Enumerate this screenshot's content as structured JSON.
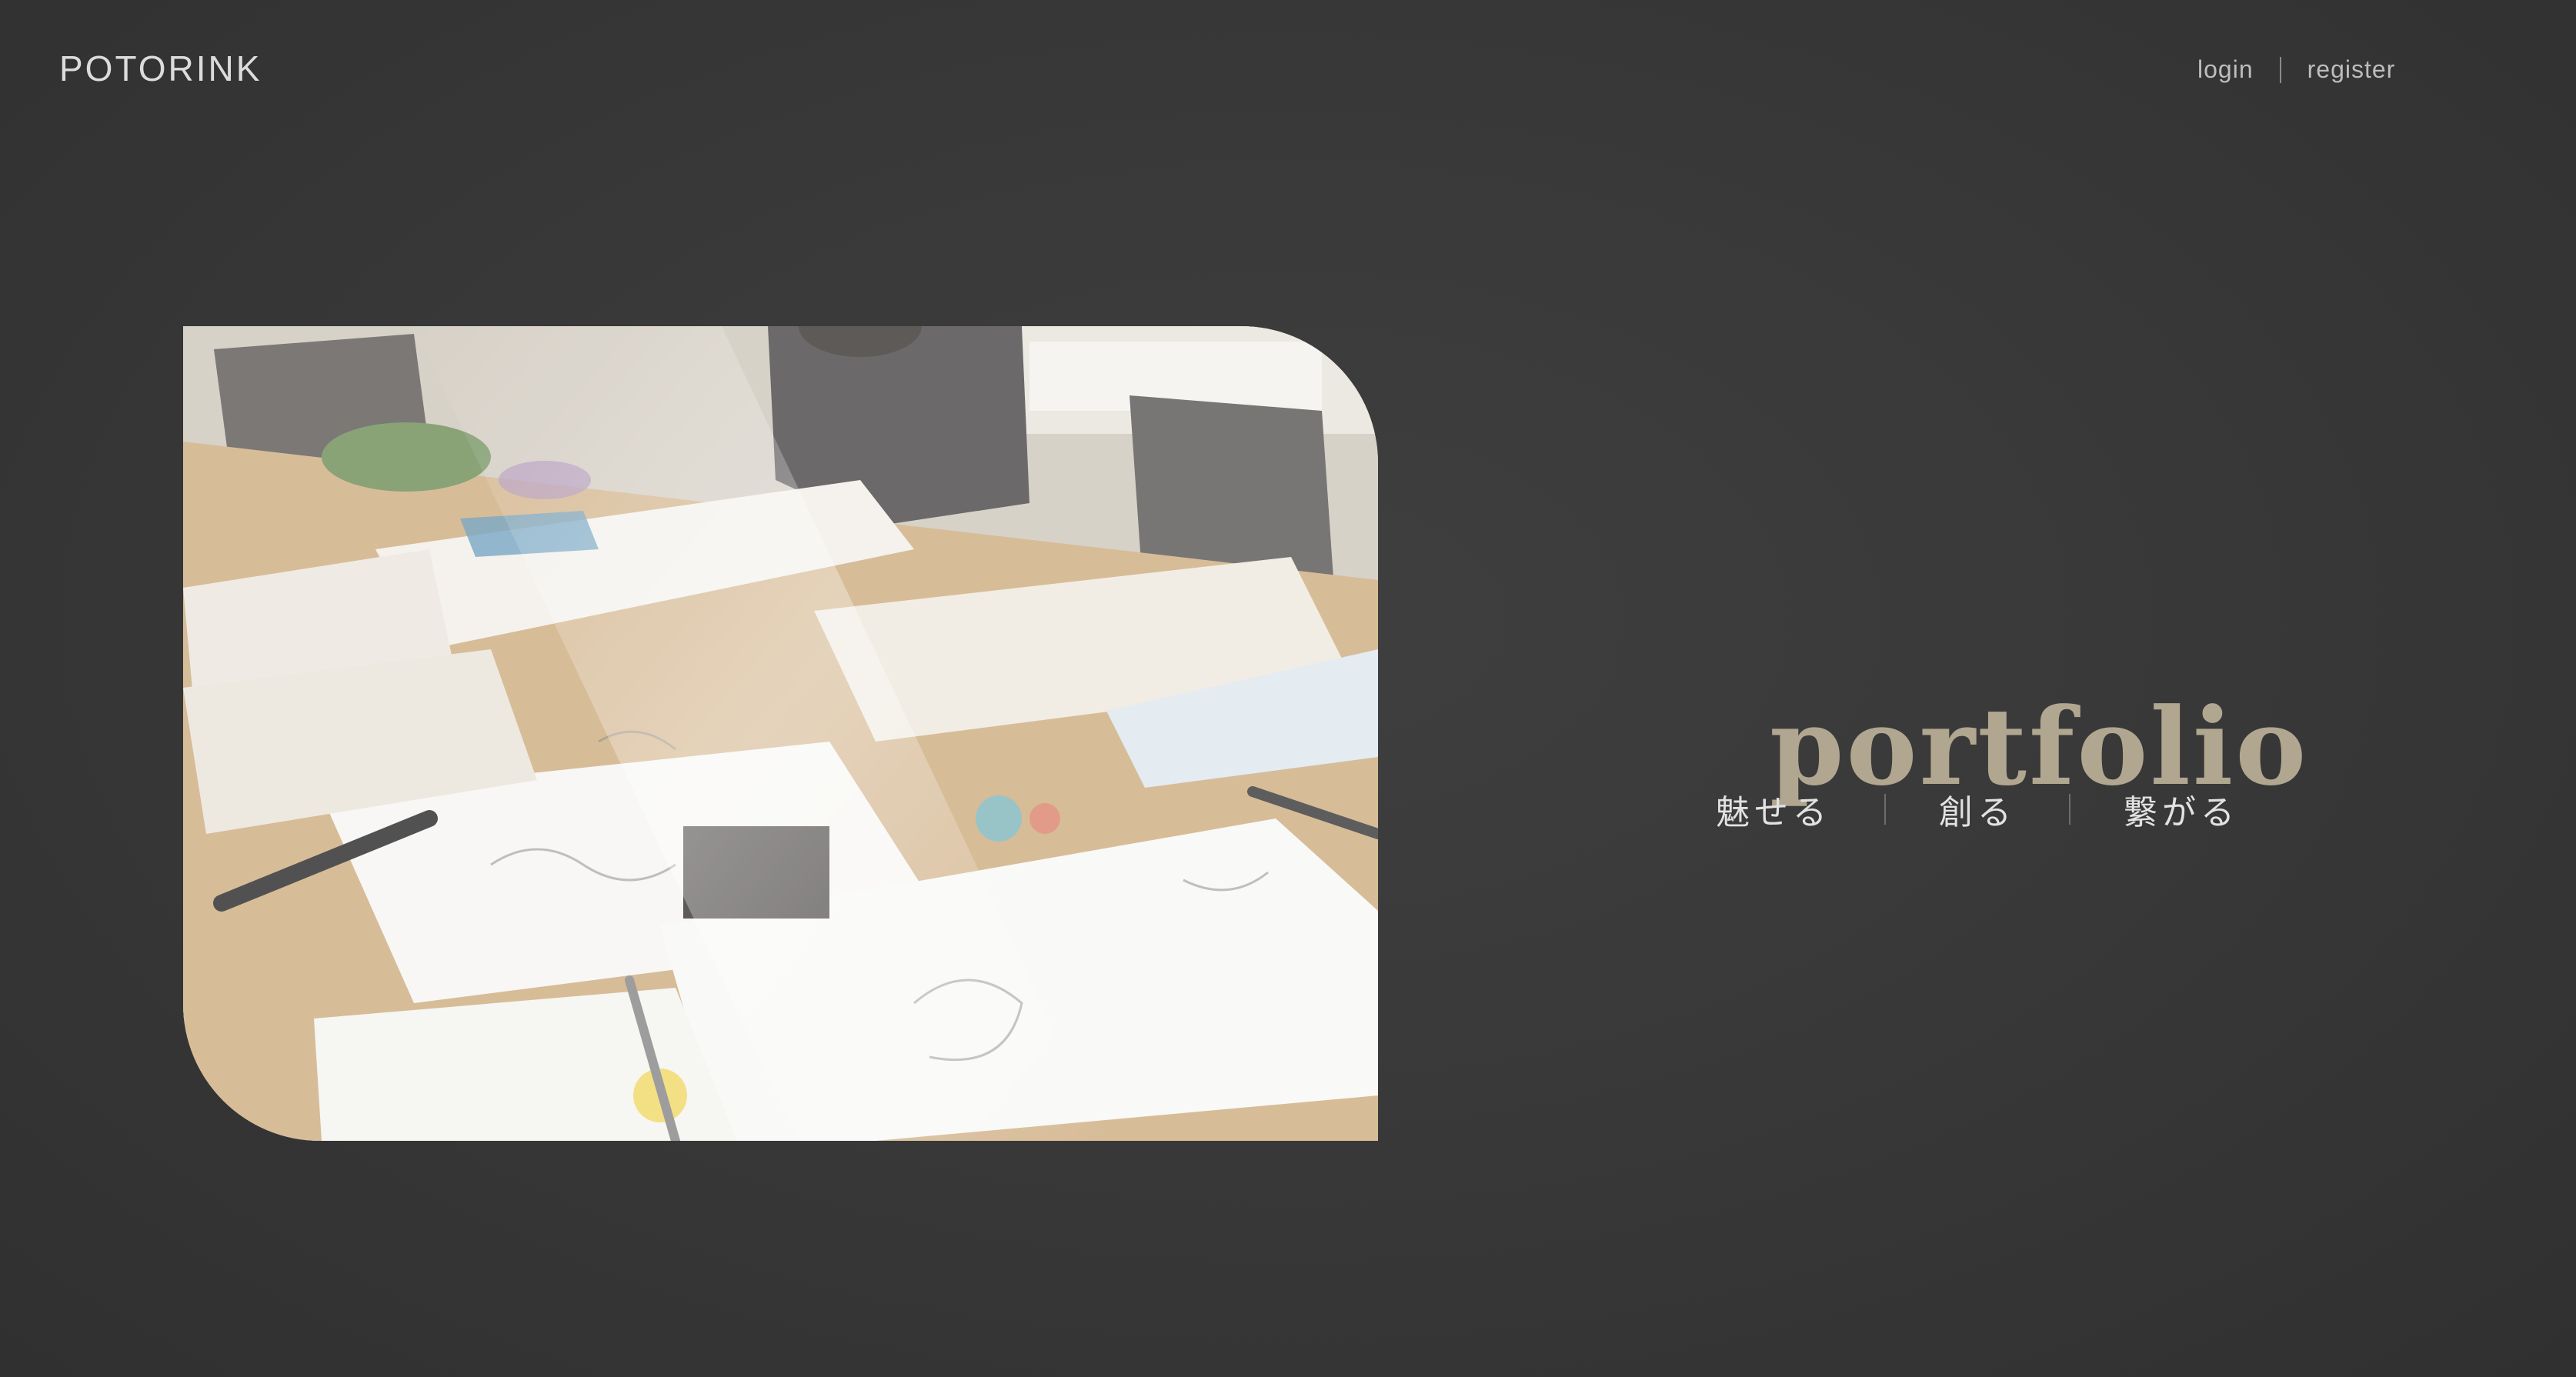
{
  "header": {
    "brand": "POTORINK",
    "login_label": "login",
    "register_label": "register"
  },
  "hero": {
    "image_alt": "Art supplies, sketchbooks and drawings spread across a sunlit table",
    "title": "portfolio",
    "taglines": [
      "魅せる",
      "創る",
      "繋がる"
    ]
  },
  "colors": {
    "background": "#393939",
    "title": "#b1a690",
    "text": "#e2e2e2"
  }
}
